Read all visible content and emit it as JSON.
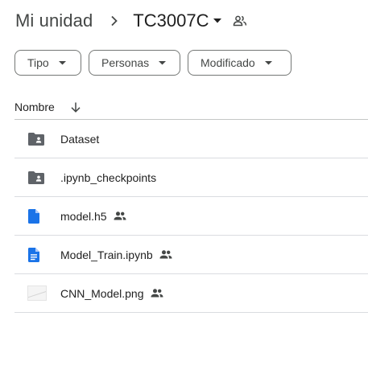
{
  "breadcrumb": {
    "root": "Mi unidad",
    "current": "TC3007C"
  },
  "filters": {
    "type": "Tipo",
    "people": "Personas",
    "modified": "Modificado"
  },
  "list": {
    "column_name": "Nombre",
    "sort": "descending",
    "items": [
      {
        "name": "Dataset",
        "icon": "shared-folder-icon",
        "shared": false
      },
      {
        "name": ".ipynb_checkpoints",
        "icon": "shared-folder-icon",
        "shared": false
      },
      {
        "name": "model.h5",
        "icon": "file-icon",
        "shared": true
      },
      {
        "name": "Model_Train.ipynb",
        "icon": "document-icon",
        "shared": true
      },
      {
        "name": "CNN_Model.png",
        "icon": "image-thumbnail",
        "shared": true
      }
    ]
  },
  "colors": {
    "folder": "#5f6368",
    "file_blue": "#1a73e8",
    "text": "#1f1f1f",
    "muted": "#444746",
    "divider": "#dadce0"
  }
}
